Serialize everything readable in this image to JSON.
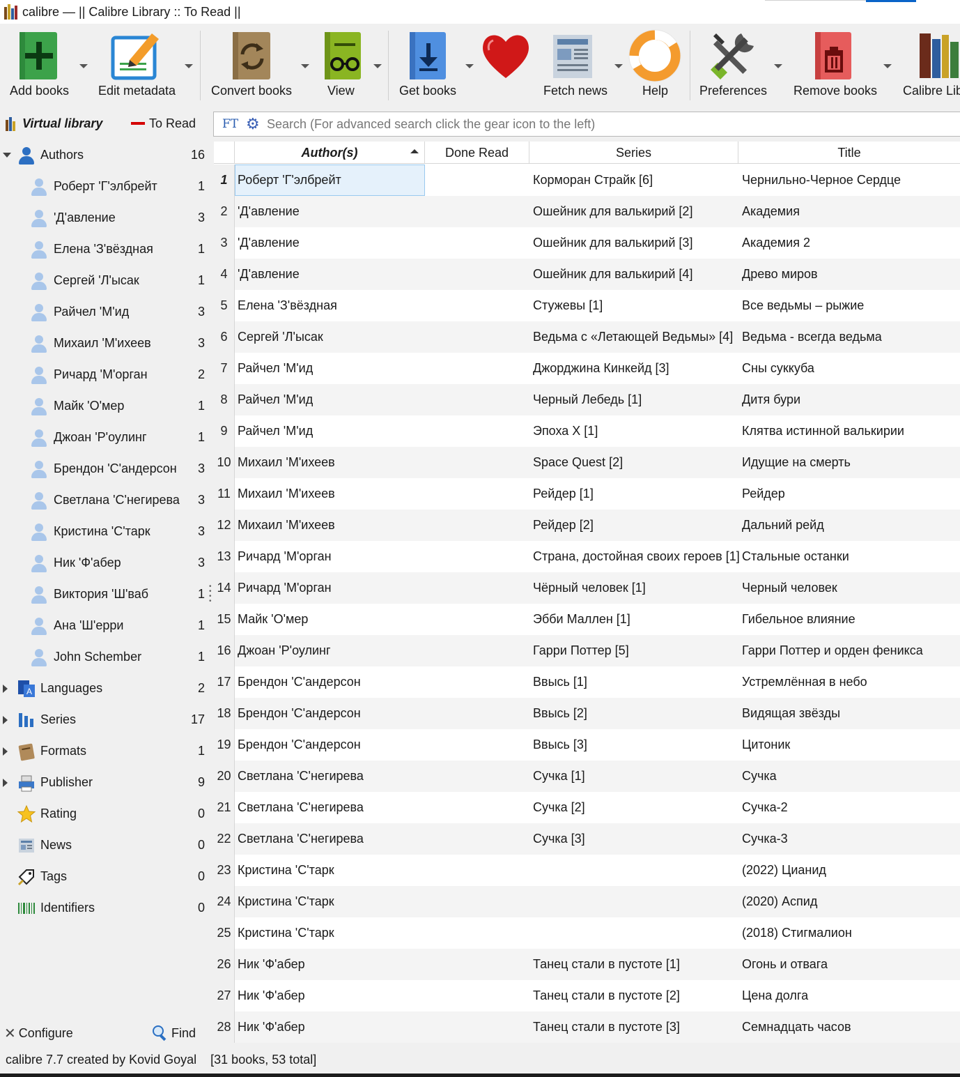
{
  "window": {
    "title": "calibre — || Calibre Library :: To Read ||"
  },
  "toolbar": {
    "add_books": "Add books",
    "edit_metadata": "Edit metadata",
    "convert_books": "Convert books",
    "view": "View",
    "get_books": "Get books",
    "fetch_news": "Fetch news",
    "help": "Help",
    "preferences": "Preferences",
    "remove_books": "Remove books",
    "calibre_library": "Calibre Library"
  },
  "search": {
    "virtual_library": "Virtual library",
    "current_vl": "To Read",
    "ft_label": "FT",
    "placeholder": "Search (For advanced search click the gear icon to the left)"
  },
  "tag_browser": {
    "authors": {
      "label": "Authors",
      "count": "16"
    },
    "author_items": [
      {
        "name": "Роберт 'Г'элбрейт",
        "count": "1"
      },
      {
        "name": "'Д'авление",
        "count": "3"
      },
      {
        "name": "Елена 'З'вёздная",
        "count": "1"
      },
      {
        "name": "Сергей 'Л'ысак",
        "count": "1"
      },
      {
        "name": "Райчел 'М'ид",
        "count": "3"
      },
      {
        "name": "Михаил 'М'ихеев",
        "count": "3"
      },
      {
        "name": "Ричард 'М'орган",
        "count": "2"
      },
      {
        "name": "Майк 'О'мер",
        "count": "1"
      },
      {
        "name": "Джоан 'Р'оулинг",
        "count": "1"
      },
      {
        "name": "Брендон 'С'андерсон",
        "count": "3"
      },
      {
        "name": "Светлана 'С'негирева",
        "count": "3"
      },
      {
        "name": "Кристина 'С'тарк",
        "count": "3"
      },
      {
        "name": "Ник 'Ф'абер",
        "count": "3"
      },
      {
        "name": "Виктория 'Ш'ваб",
        "count": "1"
      },
      {
        "name": "Ана 'Ш'ерри",
        "count": "1"
      },
      {
        "name": "John Schember",
        "count": "1"
      }
    ],
    "categories": [
      {
        "label": "Languages",
        "count": "2",
        "icon": "languages-icon"
      },
      {
        "label": "Series",
        "count": "17",
        "icon": "series-icon"
      },
      {
        "label": "Formats",
        "count": "1",
        "icon": "formats-icon"
      },
      {
        "label": "Publisher",
        "count": "9",
        "icon": "publisher-icon"
      },
      {
        "label": "Rating",
        "count": "0",
        "icon": "star-icon"
      },
      {
        "label": "News",
        "count": "0",
        "icon": "news-icon"
      },
      {
        "label": "Tags",
        "count": "0",
        "icon": "tag-icon"
      },
      {
        "label": "Identifiers",
        "count": "0",
        "icon": "barcode-icon"
      }
    ],
    "configure": "Configure",
    "find": "Find"
  },
  "table": {
    "headers": {
      "author": "Author(s)",
      "done_read": "Done Read",
      "series": "Series",
      "title": "Title"
    },
    "rows": [
      {
        "n": "1",
        "author": "Роберт 'Г'элбрейт",
        "series": "Корморан Страйк [6]",
        "title": "Чернильно-Черное Сердце"
      },
      {
        "n": "2",
        "author": "'Д'авление",
        "series": "Ошейник для валькирий [2]",
        "title": "Академия"
      },
      {
        "n": "3",
        "author": "'Д'авление",
        "series": "Ошейник для валькирий [3]",
        "title": "Академия 2"
      },
      {
        "n": "4",
        "author": "'Д'авление",
        "series": "Ошейник для валькирий [4]",
        "title": "Древо миров"
      },
      {
        "n": "5",
        "author": "Елена 'З'вёздная",
        "series": "Стужевы [1]",
        "title": "Все ведьмы – рыжие"
      },
      {
        "n": "6",
        "author": "Сергей 'Л'ысак",
        "series": "Ведьма с «Летающей Ведьмы» [4]",
        "title": "Ведьма - всегда ведьма"
      },
      {
        "n": "7",
        "author": "Райчел 'М'ид",
        "series": "Джорджина Кинкейд [3]",
        "title": "Сны суккуба"
      },
      {
        "n": "8",
        "author": "Райчел 'М'ид",
        "series": "Черный Лебедь [1]",
        "title": "Дитя бури"
      },
      {
        "n": "9",
        "author": "Райчел 'М'ид",
        "series": "Эпоха X [1]",
        "title": "Клятва истинной валькирии"
      },
      {
        "n": "10",
        "author": "Михаил 'М'ихеев",
        "series": "Space Quest [2]",
        "title": "Идущие на смерть"
      },
      {
        "n": "11",
        "author": "Михаил 'М'ихеев",
        "series": "Рейдер [1]",
        "title": "Рейдер"
      },
      {
        "n": "12",
        "author": "Михаил 'М'ихеев",
        "series": "Рейдер [2]",
        "title": "Дальний рейд"
      },
      {
        "n": "13",
        "author": "Ричард 'М'орган",
        "series": "Страна, достойная своих героев [1]",
        "title": "Стальные останки"
      },
      {
        "n": "14",
        "author": "Ричард 'М'орган",
        "series": "Чёрный человек [1]",
        "title": "Черный человек"
      },
      {
        "n": "15",
        "author": "Майк 'О'мер",
        "series": "Эбби Маллен [1]",
        "title": "Гибельное влияние"
      },
      {
        "n": "16",
        "author": "Джоан 'Р'оулинг",
        "series": "Гарри Поттер [5]",
        "title": "Гарри Поттер и орден феникса"
      },
      {
        "n": "17",
        "author": "Брендон 'С'андерсон",
        "series": "Ввысь [1]",
        "title": "Устремлённая в небо"
      },
      {
        "n": "18",
        "author": "Брендон 'С'андерсон",
        "series": "Ввысь [2]",
        "title": "Видящая звёзды"
      },
      {
        "n": "19",
        "author": "Брендон 'С'андерсон",
        "series": "Ввысь [3]",
        "title": "Цитоник"
      },
      {
        "n": "20",
        "author": "Светлана 'С'негирева",
        "series": "Сучка [1]",
        "title": "Сучка"
      },
      {
        "n": "21",
        "author": "Светлана 'С'негирева",
        "series": "Сучка [2]",
        "title": "Сучка-2"
      },
      {
        "n": "22",
        "author": "Светлана 'С'негирева",
        "series": "Сучка [3]",
        "title": "Сучка-3"
      },
      {
        "n": "23",
        "author": "Кристина 'С'тарк",
        "series": "",
        "title": "(2022) Цианид"
      },
      {
        "n": "24",
        "author": "Кристина 'С'тарк",
        "series": "",
        "title": "(2020) Аспид"
      },
      {
        "n": "25",
        "author": "Кристина 'С'тарк",
        "series": "",
        "title": "(2018) Стигмалион"
      },
      {
        "n": "26",
        "author": "Ник 'Ф'абер",
        "series": "Танец стали в пустоте [1]",
        "title": "Огонь и отвага"
      },
      {
        "n": "27",
        "author": "Ник 'Ф'абер",
        "series": "Танец стали в пустоте [2]",
        "title": "Цена долга"
      },
      {
        "n": "28",
        "author": "Ник 'Ф'абер",
        "series": "Танец стали в пустоте [3]",
        "title": "Семнадцать часов"
      }
    ]
  },
  "status": {
    "version": "calibre 7.7 created by Kovid Goyal",
    "books": "[31 books, 53 total]"
  },
  "colors": {
    "accent": "#0a64c8",
    "selection_bg": "#e5f1fb",
    "selection_border": "#99c9ef",
    "person_icon": "#3a78c9"
  }
}
